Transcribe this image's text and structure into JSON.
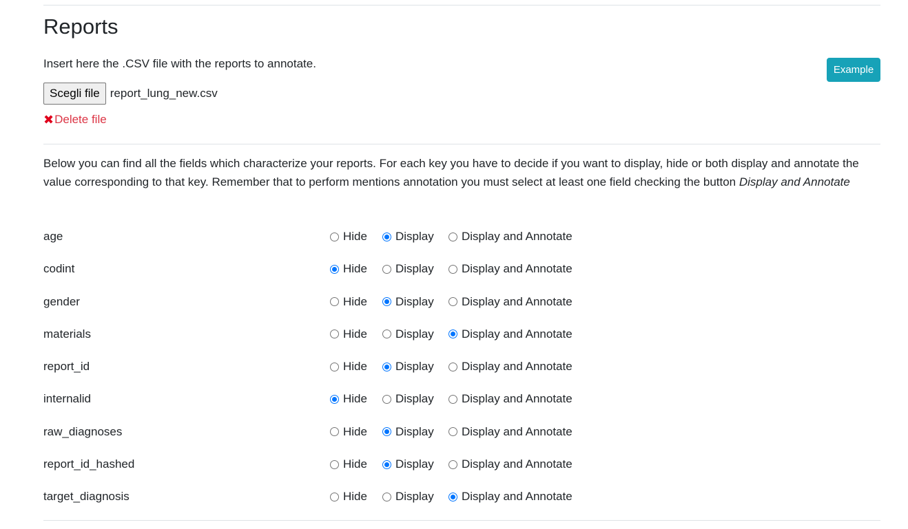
{
  "header": {
    "title": "Reports"
  },
  "upload": {
    "instruction": "Insert here the .CSV file with the reports to annotate.",
    "choose_button_label": "Scegli file",
    "file_name": "report_lung_new.csv",
    "delete_icon": "✖",
    "delete_label": "Delete file",
    "example_button_label": "Example"
  },
  "description": {
    "text": "Below you can find all the fields which characterize your reports. For each key you have to decide if you want to display, hide or both display and annotate the value corresponding to that key. Remember that to perform mentions annotation you must select at least one field checking the button ",
    "emphasis": "Display and Annotate"
  },
  "option_labels": {
    "hide": "Hide",
    "display": "Display",
    "display_annotate": "Display and Annotate"
  },
  "fields": [
    {
      "name": "age",
      "selected": "display"
    },
    {
      "name": "codint",
      "selected": "hide"
    },
    {
      "name": "gender",
      "selected": "display"
    },
    {
      "name": "materials",
      "selected": "display_annotate"
    },
    {
      "name": "report_id",
      "selected": "display"
    },
    {
      "name": "internalid",
      "selected": "hide"
    },
    {
      "name": "raw_diagnoses",
      "selected": "display"
    },
    {
      "name": "report_id_hashed",
      "selected": "display"
    },
    {
      "name": "target_diagnosis",
      "selected": "display_annotate"
    }
  ],
  "colors": {
    "example_button": "#17a2b8",
    "delete_link": "#dc3545",
    "radio_checked": "#0075ff"
  }
}
